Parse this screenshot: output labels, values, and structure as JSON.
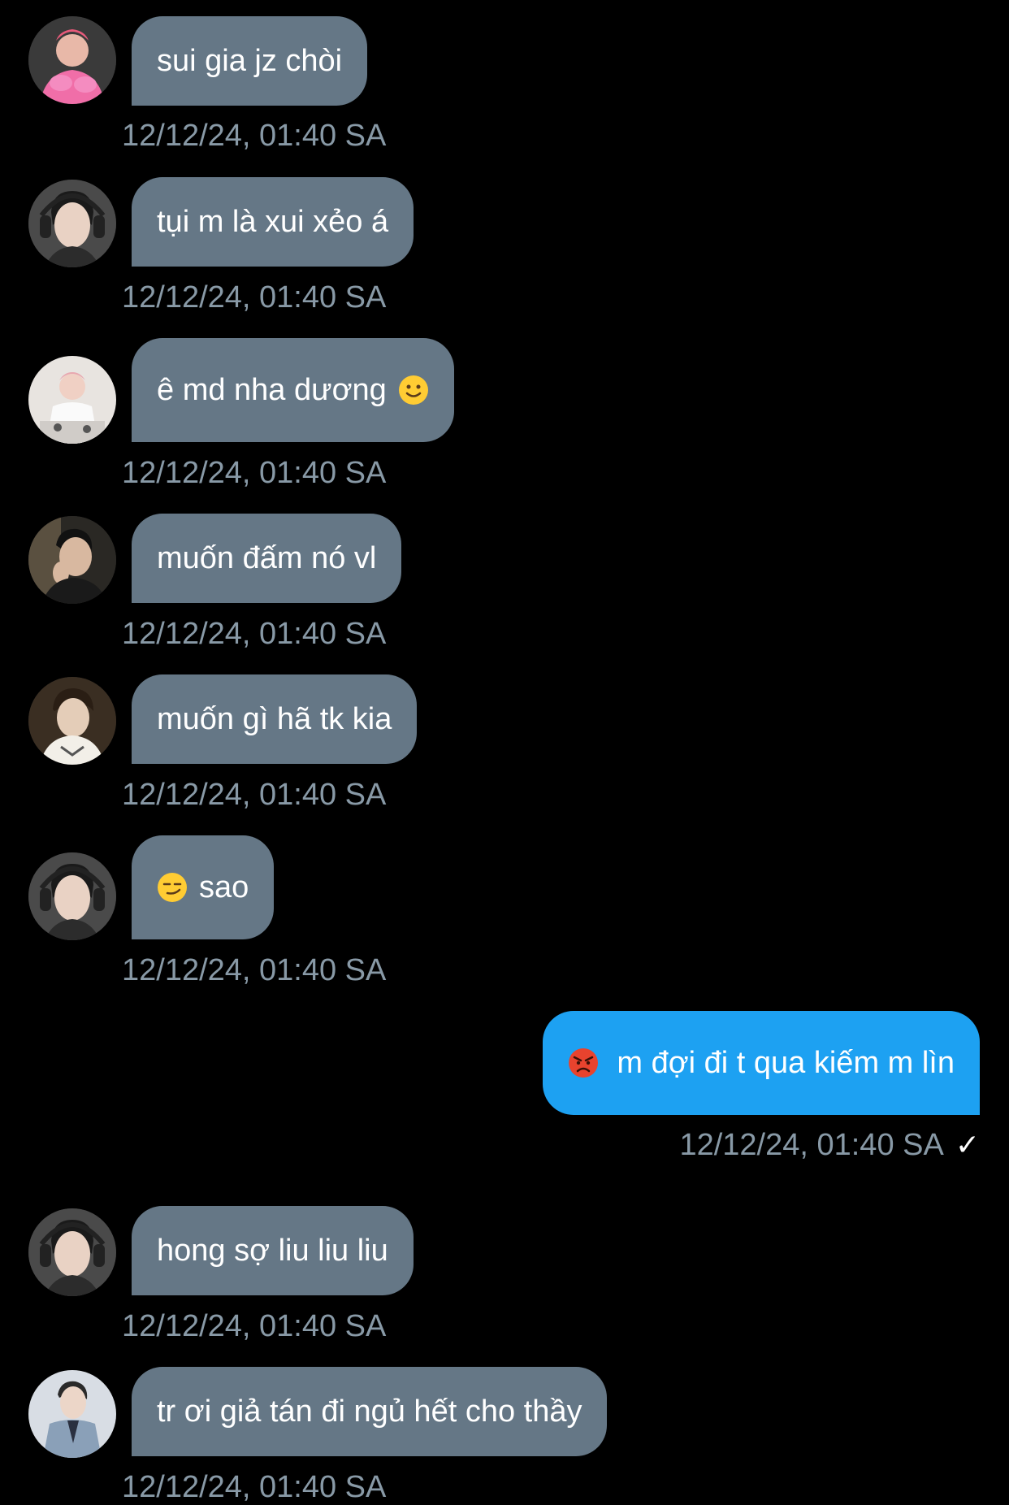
{
  "messages": [
    {
      "text": "sui gia jz chòi",
      "timestamp": "12/12/24, 01:40 SA",
      "avatar": "avatar-pink"
    },
    {
      "text": "tụi m là xui xẻo á",
      "timestamp": "12/12/24, 01:40 SA",
      "avatar": "avatar-headphones"
    },
    {
      "text": "ê md nha dương",
      "emoji_after": "slightly-smiling-face-icon",
      "timestamp": "12/12/24, 01:40 SA",
      "avatar": "avatar-white"
    },
    {
      "text": "muốn đấm nó vl",
      "timestamp": "12/12/24, 01:40 SA",
      "avatar": "avatar-dark"
    },
    {
      "text": "muốn gì hã tk kia",
      "timestamp": "12/12/24, 01:40 SA",
      "avatar": "avatar-light"
    },
    {
      "text": "sao",
      "emoji_before": "smirking-face-icon",
      "timestamp": "12/12/24, 01:40 SA",
      "avatar": "avatar-headphones"
    },
    {
      "text": "m đợi đi t qua kiếm m lìn",
      "emoji_before": "angry-face-icon",
      "timestamp": "12/12/24, 01:40 SA",
      "own": true,
      "status_icon": "check-icon"
    },
    {
      "text": "hong sợ liu liu liu",
      "timestamp": "12/12/24, 01:40 SA",
      "avatar": "avatar-headphones"
    },
    {
      "text": "tr ơi giả tán đi ngủ hết cho thầy",
      "timestamp": "12/12/24, 01:40 SA",
      "avatar": "avatar-suit"
    }
  ],
  "colors": {
    "background": "#000000",
    "incoming_bubble": "#657786",
    "outgoing_bubble": "#1da1f2",
    "timestamp": "#8899a6",
    "text": "#ffffff"
  }
}
